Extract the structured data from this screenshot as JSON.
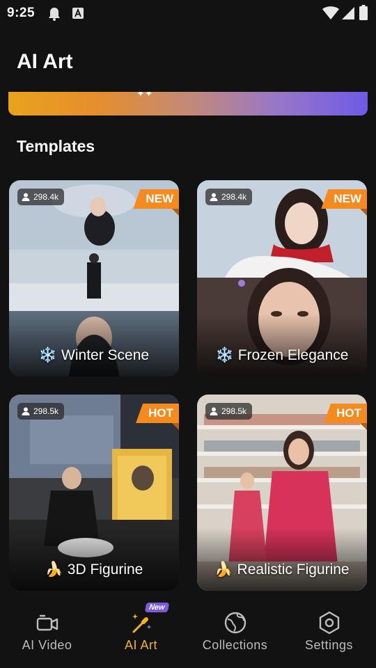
{
  "status_bar": {
    "time": "9:25"
  },
  "header": {
    "title": "AI Art"
  },
  "section": {
    "title": "Templates"
  },
  "templates": [
    {
      "views": "298.4k",
      "badge": "NEW",
      "emoji": "❄️",
      "title": "Winter Scene"
    },
    {
      "views": "298.4k",
      "badge": "NEW",
      "emoji": "❄️",
      "title": "Frozen Elegance"
    },
    {
      "views": "298.5k",
      "badge": "HOT",
      "emoji": "🍌",
      "title": "3D Figurine"
    },
    {
      "views": "298.5k",
      "badge": "HOT",
      "emoji": "🍌",
      "title": "Realistic Figurine"
    }
  ],
  "nav": {
    "items": [
      {
        "label": "AI Video",
        "icon": "video-camera-icon"
      },
      {
        "label": "AI Art",
        "icon": "magic-wand-icon",
        "tag": "New"
      },
      {
        "label": "Collections",
        "icon": "globe-icon"
      },
      {
        "label": "Settings",
        "icon": "hexagon-settings-icon"
      }
    ],
    "active": "AI Art"
  },
  "colors": {
    "accent": "#f7b21e",
    "badge": "#f58a1f",
    "background": "#121212"
  }
}
